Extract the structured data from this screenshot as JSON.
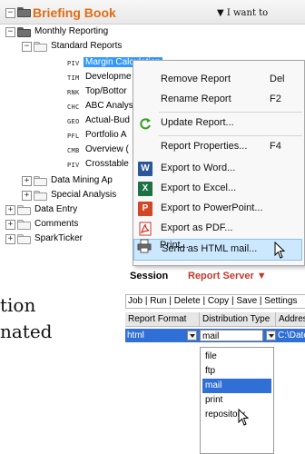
{
  "briefing_book": {
    "title": "Briefing Book",
    "i_want_to": "▼ I want to",
    "tree": {
      "monthly_reporting": "Monthly Reporting",
      "standard_reports": "Standard Reports",
      "reports": [
        {
          "code": "PIV",
          "label": "Margin Calculation"
        },
        {
          "code": "TIM",
          "label": "Developme"
        },
        {
          "code": "RNK",
          "label": "Top/Bottor"
        },
        {
          "code": "CHC",
          "label": "ABC Analys"
        },
        {
          "code": "GEO",
          "label": "Actual-Bud"
        },
        {
          "code": "PFL",
          "label": "Portfolio A"
        },
        {
          "code": "CMB",
          "label": "Overview ("
        },
        {
          "code": "PIV",
          "label": "Crosstable"
        }
      ],
      "data_mining": "Data Mining Ap",
      "special_analysis": "Special Analysis",
      "data_entry": "Data Entry",
      "comments": "Comments",
      "sparkticker": "SparkTicker"
    }
  },
  "context_menu": {
    "items": [
      {
        "label": "Remove Report",
        "shortcut": "Del"
      },
      {
        "label": "Rename Report",
        "shortcut": "F2"
      },
      {
        "label": "Update Report..."
      },
      {
        "label": "Report Properties...",
        "shortcut": "F4"
      },
      {
        "label": "Export to Word..."
      },
      {
        "label": "Export to Excel..."
      },
      {
        "label": "Export to PowerPoint..."
      },
      {
        "label": "Export as PDF..."
      },
      {
        "label": "Send as HTML mail..."
      },
      {
        "label": "Print..."
      }
    ]
  },
  "server_bar": {
    "session": "Session",
    "report_server": "Report Server ▼"
  },
  "background_text": {
    "line1": "tion",
    "line2": "nated"
  },
  "distribution": {
    "toolbar": "Job | Run | Delete | Copy | Save | Settings",
    "headers": [
      "Report Format",
      "Distribution Type",
      "Address"
    ],
    "row": {
      "format": "html",
      "type": "mail",
      "address": "C:\\Date"
    },
    "options": [
      "file",
      "ftp",
      "mail",
      "print",
      "repository"
    ],
    "selected_option": "mail"
  },
  "colors": {
    "brand_orange": "#e06d14",
    "report_server_red": "#c0392b",
    "selection_blue": "#2f6fd6",
    "hover_blue": "#cce8ff"
  }
}
